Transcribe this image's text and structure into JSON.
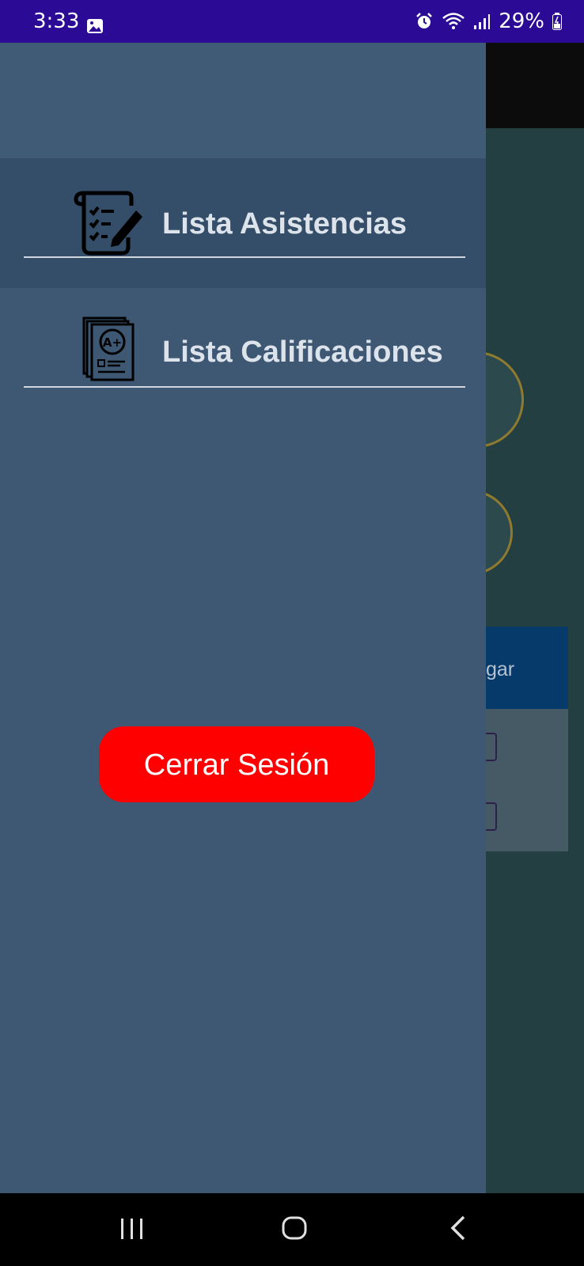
{
  "status_bar": {
    "time": "3:33",
    "battery": "29%",
    "icons": [
      "gallery-icon",
      "alarm-icon",
      "wifi-icon",
      "signal-icon",
      "battery-icon"
    ]
  },
  "background_app": {
    "table_header_partial": "gar"
  },
  "drawer": {
    "items": [
      {
        "label": "Lista Asistencias",
        "icon": "attendance-list-icon",
        "selected": true
      },
      {
        "label": "Lista Calificaciones",
        "icon": "grades-list-icon",
        "selected": false
      }
    ],
    "logout_label": "Cerrar Sesión"
  },
  "nav_bar": {
    "buttons": [
      "recents-icon",
      "home-icon",
      "back-icon"
    ]
  },
  "colors": {
    "status_bar": "#2b0b96",
    "drawer": "#3e5874",
    "drawer_selected": "#344d68",
    "logout_button": "#ff0000",
    "app_background": "#243f41"
  }
}
